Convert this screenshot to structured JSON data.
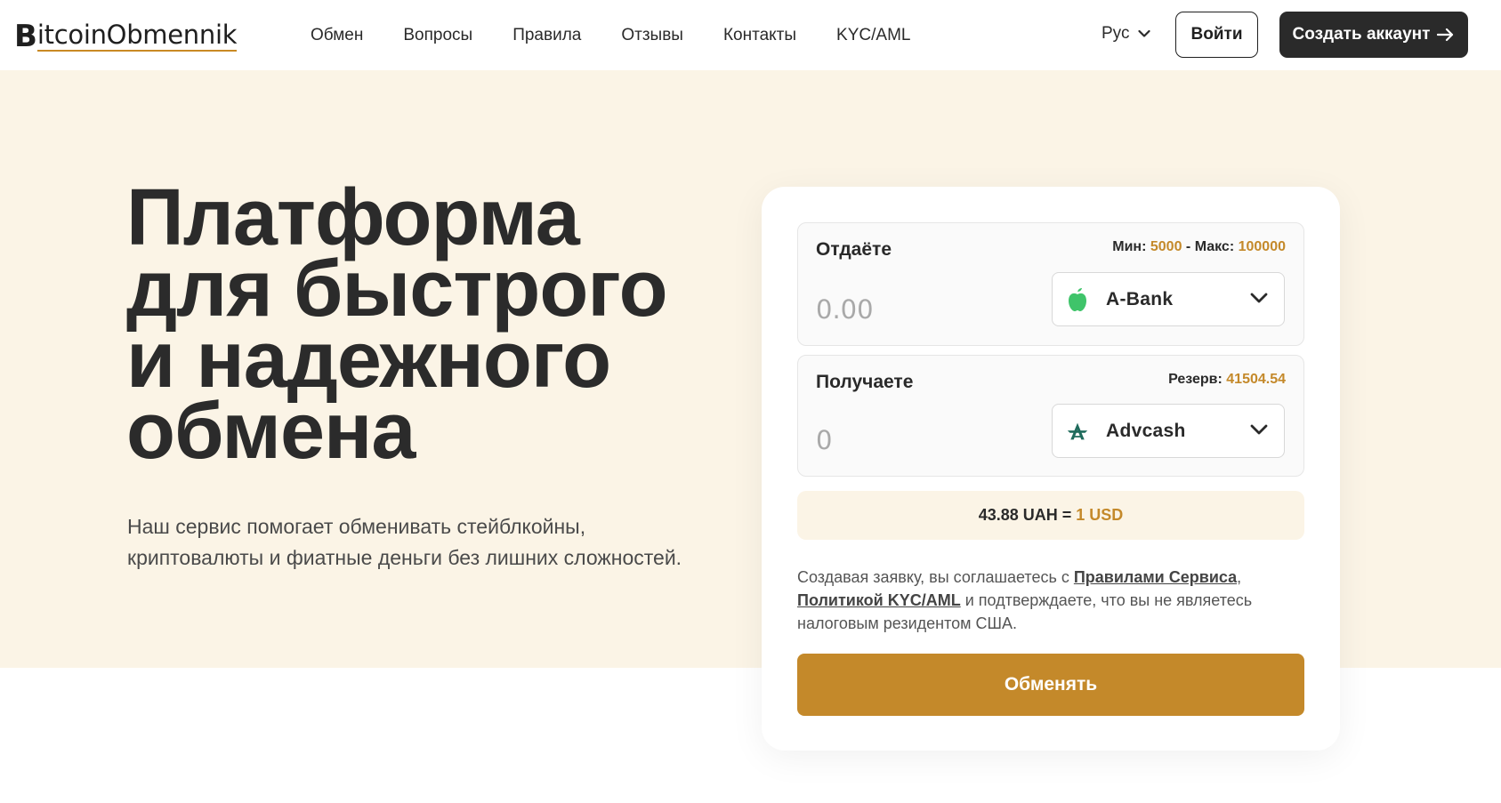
{
  "header": {
    "logo": {
      "letter": "B",
      "text": "itcoinObmennik"
    },
    "nav": [
      "Обмен",
      "Вопросы",
      "Правила",
      "Отзывы",
      "Контакты",
      "KYC/AML"
    ],
    "language": "Рус",
    "login_label": "Войти",
    "create_account_label": "Создать аккаунт"
  },
  "hero": {
    "title_lines": [
      "Платформа",
      "для быстрого",
      "и надежного",
      "обмена"
    ],
    "subtitle": "Наш сервис помогает обменивать стейблкойны, криптовалюты и фиатные деньги без лишних сложностей."
  },
  "exchange": {
    "give": {
      "label": "Отдаёте",
      "min_label": "Мин:",
      "min_value": "5000",
      "separator": "-",
      "max_label": "Макс:",
      "max_value": "100000",
      "amount_placeholder": "0.00",
      "currency": "A-Bank",
      "currency_icon": "apple-icon"
    },
    "get": {
      "label": "Получаете",
      "reserve_label": "Резерв:",
      "reserve_value": "41504.54",
      "amount_placeholder": "0",
      "currency": "Advcash",
      "currency_icon": "advcash-icon"
    },
    "rate": {
      "left": "43.88 UAH =",
      "right": "1 USD"
    },
    "terms": {
      "part1": "Создавая заявку, вы соглашаетесь с ",
      "link1": "Правилами Сервиса",
      "part2": ",",
      "link2": "Политикой KYC/AML",
      "part3": " и подтверждаете, что вы не являетесь налоговым резидентом США."
    },
    "submit_label": "Обменять"
  },
  "colors": {
    "accent": "#c4892a",
    "hero_bg": "#fbf4e6",
    "dark": "#2a2a2a"
  }
}
